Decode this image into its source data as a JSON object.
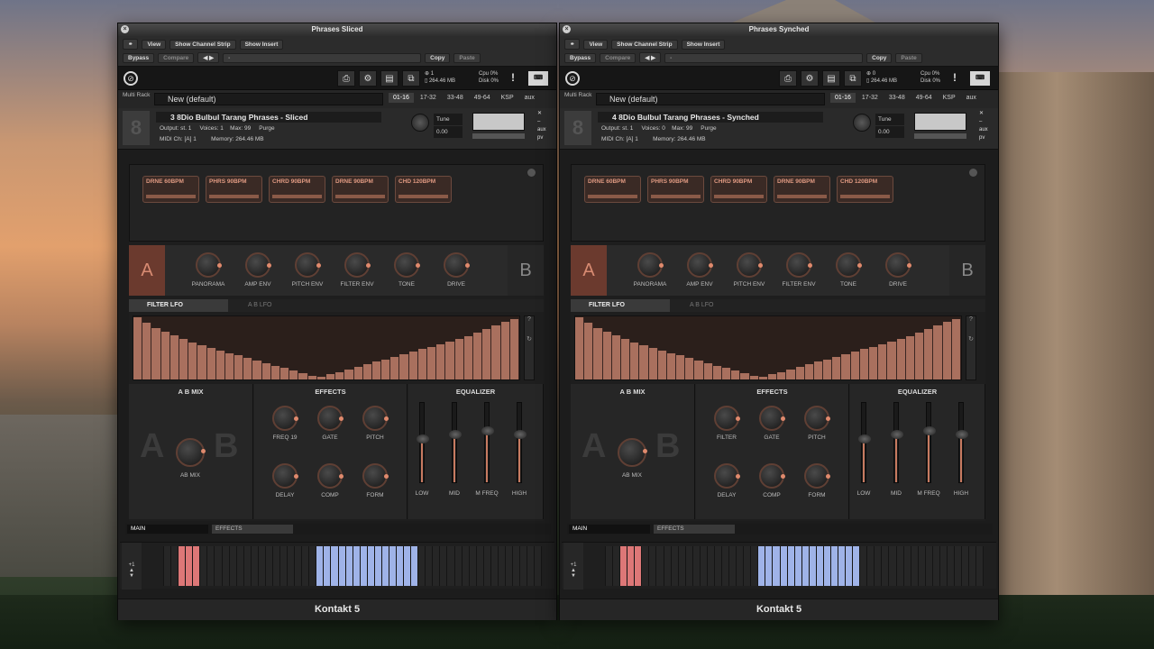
{
  "windows": [
    {
      "title": "Phrases Sliced",
      "menu": {
        "view": "View",
        "channel_strip": "Show Channel Strip",
        "insert": "Show Insert"
      },
      "row2": {
        "bypass": "Bypass",
        "compare": "Compare",
        "nav": "◀ ▶",
        "preset": "-",
        "copy": "Copy",
        "paste": "Paste"
      },
      "stats": {
        "voices": "1",
        "memory": "264.46 MB",
        "cpu": "Cpu 0%",
        "disk": "Disk 0%"
      },
      "rack": {
        "label": "Multi Rack",
        "name": "New (default)",
        "tabs": [
          "01-16",
          "17-32",
          "33-48",
          "49-64",
          "KSP",
          "aux"
        ]
      },
      "instrument": {
        "name": "3 8Dio Bulbul Tarang Phrases - Sliced",
        "output_label": "Output:",
        "output": "st. 1",
        "voices_label": "Voices:",
        "voices": "1",
        "max_label": "Max:",
        "max": "99",
        "purge": "Purge",
        "midi_label": "MIDI Ch:",
        "midi": "[A] 1",
        "memory_label": "Memory:",
        "memory": "264.46 MB",
        "tune_label": "Tune",
        "tune": "0.00"
      },
      "phrases": [
        "DRNE 60BPM",
        "PHRS 90BPM",
        "CHRD 90BPM",
        "DRNE 90BPM",
        "CHD 120BPM"
      ],
      "ab_knobs": [
        "PANORAMA",
        "AMP ENV",
        "PITCH ENV",
        "FILTER ENV",
        "TONE",
        "DRIVE"
      ],
      "ab": {
        "a": "A",
        "b": "B"
      },
      "lfo_tabs": [
        "FILTER LFO",
        "A B LFO"
      ],
      "lfo_values": [
        0.98,
        0.9,
        0.82,
        0.76,
        0.7,
        0.64,
        0.58,
        0.54,
        0.5,
        0.46,
        0.42,
        0.38,
        0.34,
        0.3,
        0.26,
        0.22,
        0.18,
        0.14,
        0.1,
        0.06,
        0.04,
        0.08,
        0.12,
        0.16,
        0.2,
        0.24,
        0.28,
        0.32,
        0.36,
        0.4,
        0.44,
        0.48,
        0.52,
        0.56,
        0.6,
        0.64,
        0.68,
        0.74,
        0.8,
        0.86,
        0.92,
        0.96
      ],
      "panels": {
        "abmix": "A B MIX",
        "abmix_knob": "AB MIX",
        "effects": "EFFECTS",
        "equalizer": "EQUALIZER"
      },
      "effects_knobs": [
        "FREQ  19",
        "GATE",
        "PITCH",
        "DELAY",
        "COMP",
        "FORM"
      ],
      "eq_labels": [
        "LOW",
        "MID",
        "M FREQ",
        "HIGH"
      ],
      "eq_levels": [
        0.55,
        0.6,
        0.65,
        0.6
      ],
      "bottom_tabs": [
        "MAIN",
        "EFFECTS"
      ],
      "footer": "Kontakt 5",
      "keyboard_octave": "+1"
    },
    {
      "title": "Phrases Synched",
      "menu": {
        "view": "View",
        "channel_strip": "Show Channel Strip",
        "insert": "Show Insert"
      },
      "row2": {
        "bypass": "Bypass",
        "compare": "Compare",
        "nav": "◀ ▶",
        "preset": "-",
        "copy": "Copy",
        "paste": "Paste"
      },
      "stats": {
        "voices": "0",
        "memory": "264.46 MB",
        "cpu": "Cpu 0%",
        "disk": "Disk 0%"
      },
      "rack": {
        "label": "Multi Rack",
        "name": "New (default)",
        "tabs": [
          "01-16",
          "17-32",
          "33-48",
          "49-64",
          "KSP",
          "aux"
        ]
      },
      "instrument": {
        "name": "4 8Dio Bulbul Tarang Phrases - Synched",
        "output_label": "Output:",
        "output": "st. 1",
        "voices_label": "Voices:",
        "voices": "0",
        "max_label": "Max:",
        "max": "99",
        "purge": "Purge",
        "midi_label": "MIDI Ch:",
        "midi": "[A] 1",
        "memory_label": "Memory:",
        "memory": "264.46 MB",
        "tune_label": "Tune",
        "tune": "0.00"
      },
      "phrases": [
        "DRNE 60BPM",
        "PHRS 90BPM",
        "CHRD 90BPM",
        "DRNE 90BPM",
        "CHD 120BPM"
      ],
      "ab_knobs": [
        "PANORAMA",
        "AMP ENV",
        "PITCH ENV",
        "FILTER ENV",
        "TONE",
        "DRIVE"
      ],
      "ab": {
        "a": "A",
        "b": "B"
      },
      "lfo_tabs": [
        "FILTER LFO",
        "A B LFO"
      ],
      "lfo_values": [
        0.98,
        0.9,
        0.82,
        0.76,
        0.7,
        0.64,
        0.58,
        0.54,
        0.5,
        0.46,
        0.42,
        0.38,
        0.34,
        0.3,
        0.26,
        0.22,
        0.18,
        0.14,
        0.1,
        0.06,
        0.04,
        0.08,
        0.12,
        0.16,
        0.2,
        0.24,
        0.28,
        0.32,
        0.36,
        0.4,
        0.44,
        0.48,
        0.52,
        0.56,
        0.6,
        0.64,
        0.68,
        0.74,
        0.8,
        0.86,
        0.92,
        0.96
      ],
      "panels": {
        "abmix": "A B MIX",
        "abmix_knob": "AB MIX",
        "effects": "EFFECTS",
        "equalizer": "EQUALIZER"
      },
      "effects_knobs": [
        "FILTER",
        "GATE",
        "PITCH",
        "DELAY",
        "COMP",
        "FORM"
      ],
      "eq_labels": [
        "LOW",
        "MID",
        "M FREQ",
        "HIGH"
      ],
      "eq_levels": [
        0.55,
        0.6,
        0.65,
        0.6
      ],
      "bottom_tabs": [
        "MAIN",
        "EFFECTS"
      ],
      "footer": "Kontakt 5",
      "keyboard_octave": "+1"
    }
  ]
}
